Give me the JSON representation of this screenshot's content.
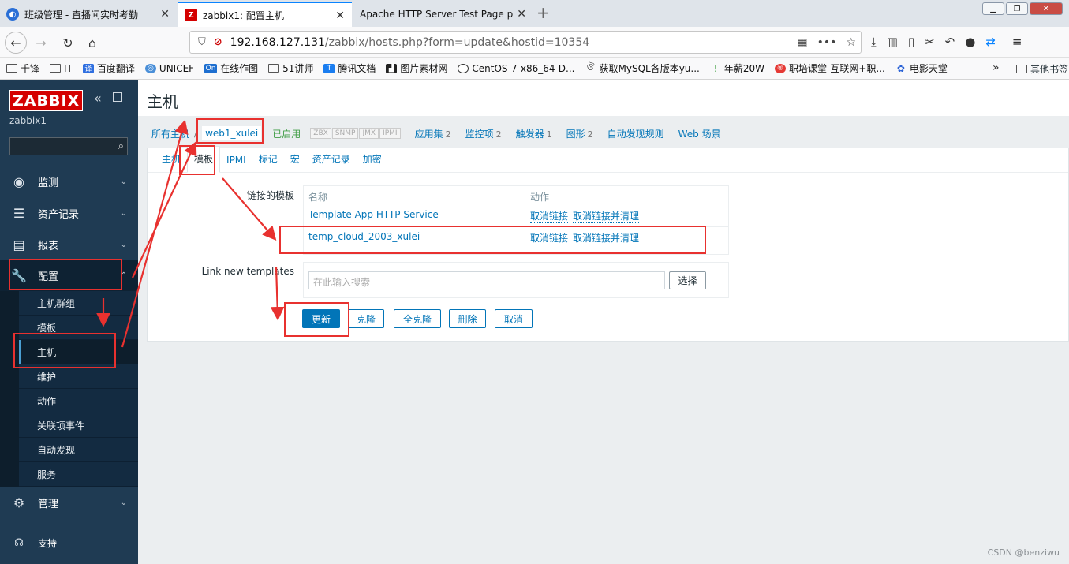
{
  "browser": {
    "tabs": [
      {
        "label": "班级管理 - 直播间实时考勤",
        "active": false
      },
      {
        "label": "zabbix1: 配置主机",
        "active": true
      },
      {
        "label": "Apache HTTP Server Test Page p",
        "active": false
      }
    ],
    "url_host": "192.168.127.131",
    "url_path": "/zabbix/hosts.php?form=update&hostid=10354",
    "bookmarks": [
      "千锋",
      "IT",
      "百度翻译",
      "UNICEF",
      "在线作图",
      "51讲师",
      "腾讯文档",
      "图片素材网",
      "CentOS-7-x86_64-D...",
      "获取MySQL各版本yu...",
      "年薪20W",
      "职培课堂-互联网+职...",
      "电影天堂"
    ],
    "other_bookmarks": "其他书签"
  },
  "sidebar": {
    "logo": "ZABBIX",
    "user": "zabbix1",
    "menu": [
      {
        "label": "监测",
        "icon": "eye-icon"
      },
      {
        "label": "资产记录",
        "icon": "list-icon"
      },
      {
        "label": "报表",
        "icon": "bar-chart-icon"
      },
      {
        "label": "配置",
        "icon": "wrench-icon"
      },
      {
        "label": "管理",
        "icon": "gear-icon"
      }
    ],
    "submenu": [
      "主机群组",
      "模板",
      "主机",
      "维护",
      "动作",
      "关联项事件",
      "自动发现",
      "服务"
    ],
    "support": "支持"
  },
  "main": {
    "title": "主机",
    "breadcrumb": {
      "all_hosts": "所有主机",
      "current": "web1_xulei",
      "status": "已启用",
      "badges": [
        "ZBX",
        "SNMP",
        "JMX",
        "IPMI"
      ],
      "links": [
        {
          "label": "应用集",
          "count": "2"
        },
        {
          "label": "监控项",
          "count": "2"
        },
        {
          "label": "触发器",
          "count": "1"
        },
        {
          "label": "图形",
          "count": "2"
        },
        {
          "label": "自动发现规则",
          "count": ""
        },
        {
          "label": "Web 场景",
          "count": ""
        }
      ]
    },
    "tabs": [
      "主机",
      "模板",
      "IPMI",
      "标记",
      "宏",
      "资产记录",
      "加密"
    ],
    "linked_templates_label": "链接的模板",
    "table_headers": {
      "name": "名称",
      "action": "动作"
    },
    "templates": [
      {
        "name": "Template App HTTP Service",
        "unlink": "取消链接",
        "unlink_clear": "取消链接并清理"
      },
      {
        "name": "temp_cloud_2003_xulei",
        "unlink": "取消链接",
        "unlink_clear": "取消链接并清理"
      }
    ],
    "link_new_label": "Link new templates",
    "search_placeholder": "在此输入搜索",
    "select_button": "选择",
    "buttons": {
      "update": "更新",
      "clone": "克隆",
      "full_clone": "全克隆",
      "delete": "删除",
      "cancel": "取消"
    }
  },
  "watermark": "CSDN @benziwu",
  "colors": {
    "annotation": "#e8312f",
    "zabbix_blue": "#0275b8",
    "sidebar": "#1f3b53"
  }
}
